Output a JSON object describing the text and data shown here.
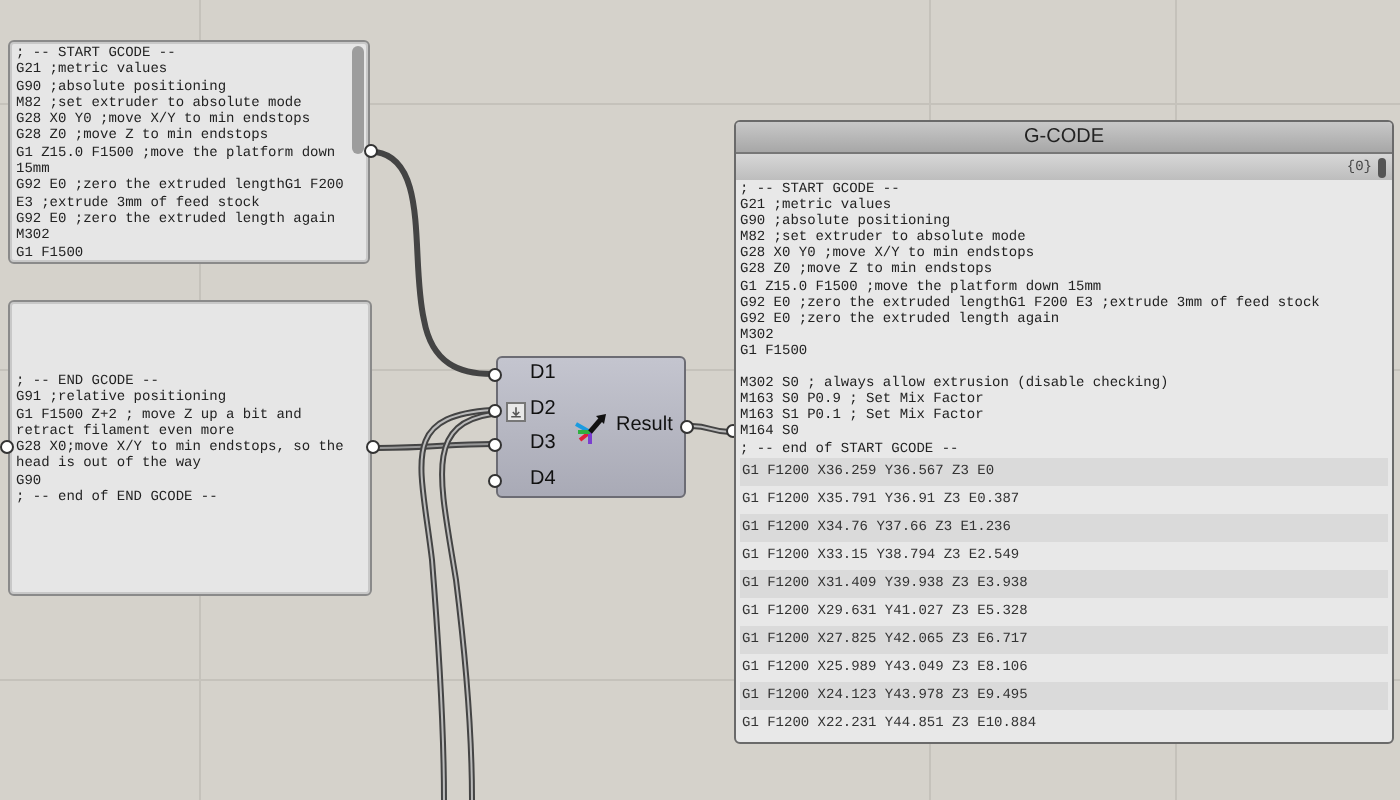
{
  "panels": [
    {
      "lines": [
        "; -- START GCODE --",
        "G21 ;metric values",
        "G90 ;absolute positioning",
        "M82 ;set extruder to absolute mode",
        "G28 X0 Y0 ;move X/Y to min endstops",
        "G28 Z0 ;move Z to min endstops",
        "G1 Z15.0 F1500 ;move the platform down 15mm",
        "G92 E0 ;zero the extruded lengthG1 F200 E3 ;extrude 3mm of feed stock",
        "G92 E0 ;zero the extruded length again",
        "M302",
        "G1 F1500"
      ]
    },
    {
      "lines": [
        "; -- END GCODE --",
        "G91 ;relative positioning",
        "G1 F1500 Z+2 ; move Z up a bit and retract filament even more",
        "G28 X0;move X/Y to min endstops, so the head is out of the way",
        "G90",
        "; -- end of END GCODE --"
      ]
    }
  ],
  "component": {
    "inputs": [
      {
        "label": "D1",
        "kind": "plain"
      },
      {
        "label": "D2",
        "kind": "flatten"
      },
      {
        "label": "D3",
        "kind": "plain"
      },
      {
        "label": "D4",
        "kind": "plain"
      }
    ],
    "output": "Result"
  },
  "output_panel": {
    "title": "G-CODE",
    "path": "{0}",
    "blocks": [
      {
        "lines": [
          "; -- START GCODE --",
          "G21 ;metric values",
          "G90 ;absolute positioning",
          "M82 ;set extruder to absolute mode",
          "G28 X0 Y0 ;move X/Y to min endstops",
          "G28 Z0 ;move Z to min endstops",
          "G1 Z15.0 F1500 ;move the platform down 15mm",
          "G92 E0 ;zero the extruded lengthG1 F200 E3 ;extrude 3mm of feed stock",
          "G92 E0 ;zero the extruded length again",
          "M302",
          "G1 F1500"
        ]
      },
      {
        "lines": [
          "M302 S0 ; always allow extrusion (disable checking)",
          "M163 S0 P0.9 ; Set Mix Factor",
          "M163 S1 P0.1 ; Set Mix Factor",
          "M164 S0",
          "; -- end of START GCODE --"
        ]
      }
    ],
    "rows": [
      "G1 F1200 X36.259 Y36.567 Z3 E0",
      "G1 F1200 X35.791 Y36.91 Z3 E0.387",
      "G1 F1200 X34.76 Y37.66 Z3 E1.236",
      "G1 F1200 X33.15 Y38.794 Z3 E2.549",
      "G1 F1200 X31.409 Y39.938 Z3 E3.938",
      "G1 F1200 X29.631 Y41.027 Z3 E5.328",
      "G1 F1200 X27.825 Y42.065 Z3 E6.717",
      "G1 F1200 X25.989 Y43.049 Z3 E8.106",
      "G1 F1200 X24.123 Y43.978 Z3 E9.495",
      "G1 F1200 X22.231 Y44.851 Z3 E10.884"
    ]
  }
}
